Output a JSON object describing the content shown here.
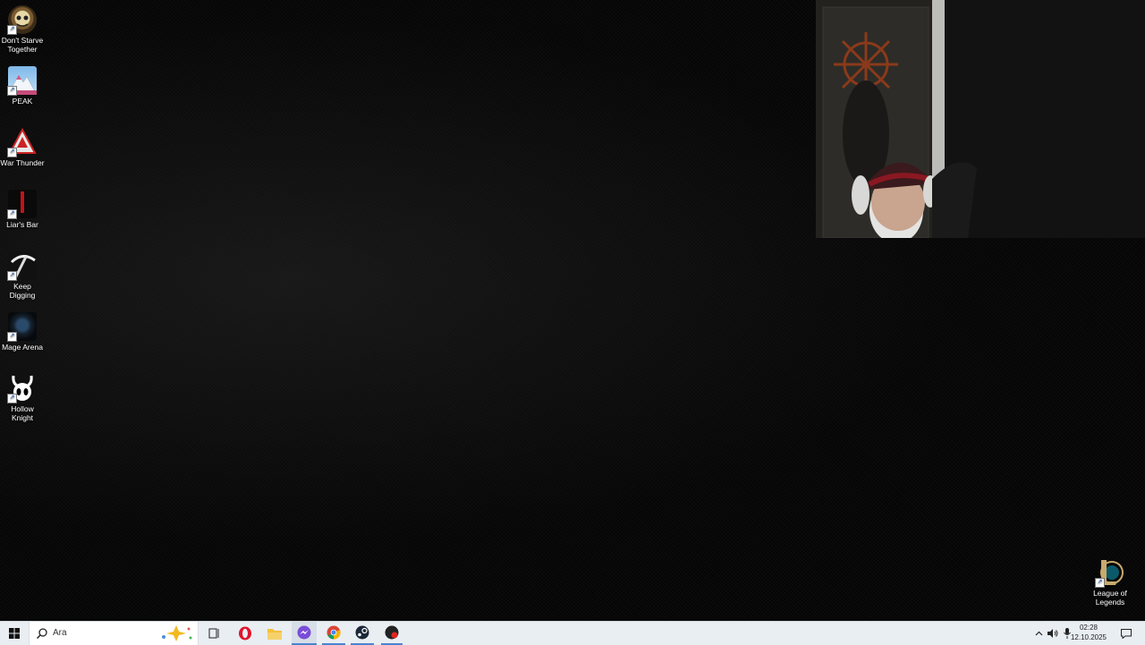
{
  "desktop_icons": [
    {
      "label": "Don't Starve Together",
      "icon": "dont-starve-together-icon"
    },
    {
      "label": "PEAK",
      "icon": "peak-icon"
    },
    {
      "label": "War Thunder",
      "icon": "war-thunder-icon"
    },
    {
      "label": "Liar's Bar",
      "icon": "liars-bar-icon"
    },
    {
      "label": "Keep Digging",
      "icon": "keep-digging-icon"
    },
    {
      "label": "Mage Arena",
      "icon": "mage-arena-icon"
    },
    {
      "label": "Hollow Knight",
      "icon": "hollow-knight-icon"
    },
    {
      "label": "League of Legends",
      "icon": "league-of-legends-icon"
    }
  ],
  "taskbar": {
    "search_placeholder": "Ara",
    "pinned": [
      "task-view-icon",
      "opera-icon",
      "file-explorer-icon",
      "messenger-icon",
      "chrome-icon",
      "steam-icon",
      "riot-client-icon"
    ],
    "clock_time": "02:28",
    "clock_date": "12.10.2025"
  },
  "colors": {
    "taskbar_bg": "#e9eef3",
    "desktop_bg": "#050505"
  }
}
